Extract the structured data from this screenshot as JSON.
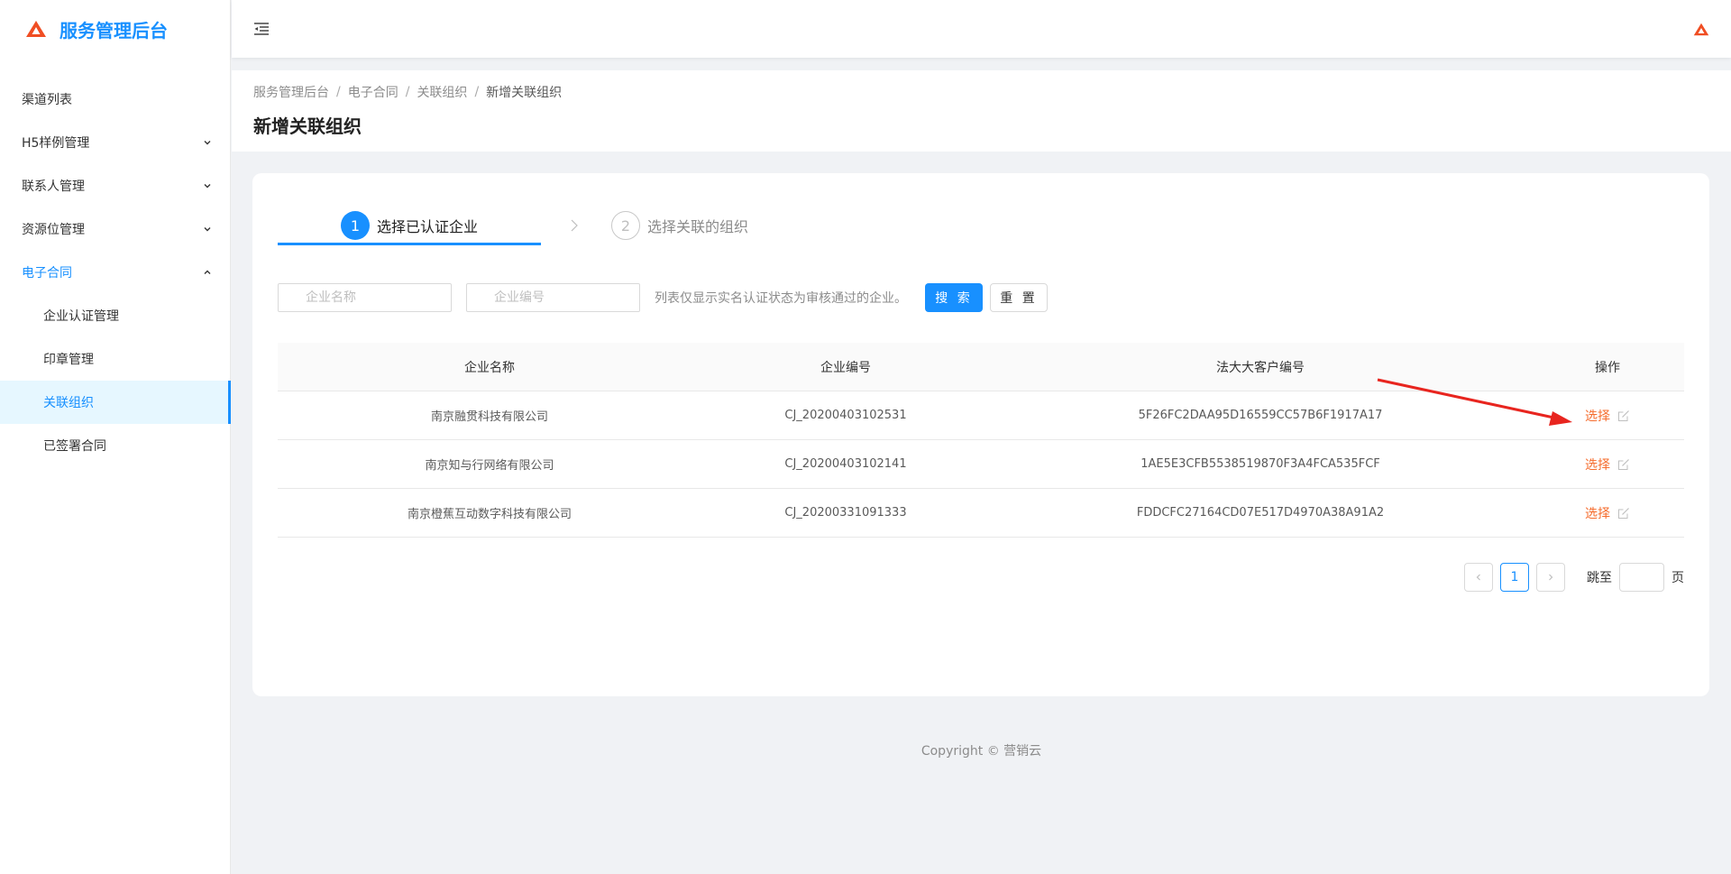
{
  "app": {
    "title": "服务管理后台"
  },
  "sidebar": {
    "items": [
      {
        "label": "渠道列表"
      },
      {
        "label": "H5样例管理"
      },
      {
        "label": "联系人管理"
      },
      {
        "label": "资源位管理"
      },
      {
        "label": "电子合同"
      },
      {
        "label": "企业认证管理"
      },
      {
        "label": "印章管理"
      },
      {
        "label": "关联组织"
      },
      {
        "label": "已签署合同"
      }
    ]
  },
  "breadcrumb": [
    "服务管理后台",
    "电子合同",
    "关联组织",
    "新增关联组织"
  ],
  "breadcrumb_sep": "/",
  "page_title": "新增关联组织",
  "steps": [
    {
      "num": "1",
      "label": "选择已认证企业"
    },
    {
      "num": "2",
      "label": "选择关联的组织"
    }
  ],
  "filters": {
    "name_placeholder": "企业名称",
    "code_placeholder": "企业编号",
    "hint": "列表仅显示实名认证状态为审核通过的企业。",
    "search_label": "搜 索",
    "reset_label": "重 置"
  },
  "table": {
    "headers": [
      "企业名称",
      "企业编号",
      "法大大客户编号",
      "操作"
    ],
    "rows": [
      {
        "name": "南京融贯科技有限公司",
        "code": "CJ_20200403102531",
        "fdd": "5F26FC2DAA95D16559CC57B6F1917A17",
        "op": "选择"
      },
      {
        "name": "南京知与行网络有限公司",
        "code": "CJ_20200403102141",
        "fdd": "1AE5E3CFB5538519870F3A4FCA535FCF",
        "op": "选择"
      },
      {
        "name": "南京橙蕉互动数字科技有限公司",
        "code": "CJ_20200331091333",
        "fdd": "FDDCFC27164CD07E517D4970A38A91A2",
        "op": "选择"
      }
    ]
  },
  "pagination": {
    "current": "1",
    "jump_label": "跳至",
    "jump_unit": "页"
  },
  "footer": "Copyright © 营销云",
  "colors": {
    "primary": "#1890ff",
    "op_link": "#f56c2d",
    "logo": "#f04e23",
    "annotation": "#e8251f"
  }
}
